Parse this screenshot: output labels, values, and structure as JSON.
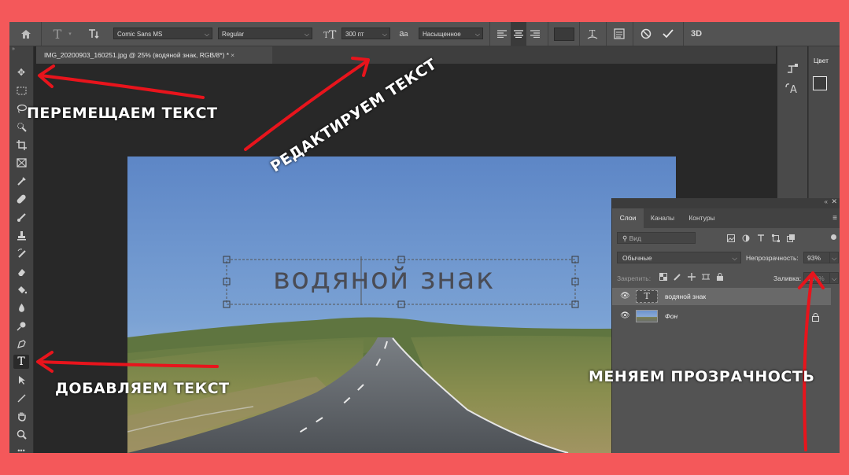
{
  "options_bar": {
    "font_family": "Comic Sans MS",
    "font_style": "Regular",
    "font_size": "300 пт",
    "antialias_label": "a",
    "antialias_mode": "Насыщенное",
    "threed_label": "3D",
    "text_icon_label": "T"
  },
  "document_tab": {
    "title": "IMG_20200903_160251.jpg @ 25% (водяной знак, RGB/8*) *",
    "close": "×"
  },
  "watermark_text": "водяной знак",
  "right_dock": {
    "color_panel_title": "Цвет"
  },
  "layers_panel": {
    "tabs": [
      "Слои",
      "Каналы",
      "Контуры"
    ],
    "search_placeholder": "Вид",
    "blend_mode": "Обычные",
    "opacity_label": "Непрозрачность:",
    "opacity_value": "93%",
    "lock_label": "Закрепить:",
    "fill_label": "Заливка:",
    "fill_value": "100%",
    "layers": [
      {
        "name": "водяной знак",
        "type": "text",
        "thumb": "T"
      },
      {
        "name": "Фон",
        "type": "image"
      }
    ]
  },
  "captions": {
    "move_text": "ПЕРЕМЕЩАЕМ ТЕКСТ",
    "edit_text": "РЕДАКТИРУЕМ ТЕКСТ",
    "add_text": "ДОБАВЛЯЕМ ТЕКСТ",
    "change_opacity": "МЕНЯЕМ ПРОЗРАЧНОСТЬ"
  },
  "colors": {
    "frame": "#f4585a",
    "arrow": "#e8141c",
    "app_bg": "#282828",
    "panel": "#535353"
  }
}
